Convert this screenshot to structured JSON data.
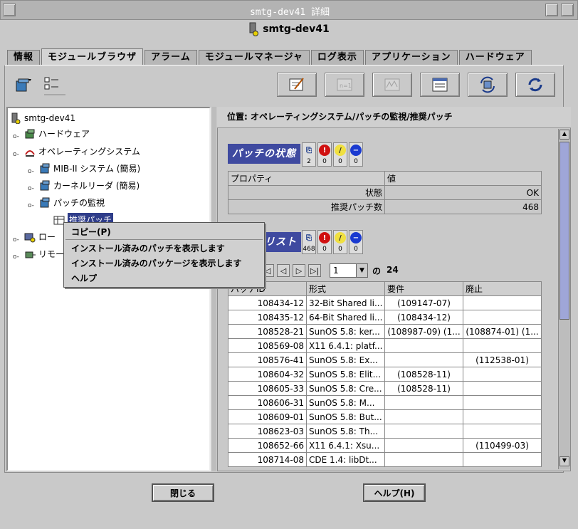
{
  "window": {
    "title": "smtg-dev41 詳細",
    "header": "smtg-dev41"
  },
  "tabs": [
    {
      "label": "情報"
    },
    {
      "label": "モジュールブラウザ",
      "active": true
    },
    {
      "label": "アラーム"
    },
    {
      "label": "モジュールマネージャ"
    },
    {
      "label": "ログ表示"
    },
    {
      "label": "アプリケーション"
    },
    {
      "label": "ハードウェア"
    }
  ],
  "tree": {
    "root": "smtg-dev41",
    "items": {
      "hardware": "ハードウェア",
      "os": "オペレーティングシステム",
      "mib2": "MIB-II システム (簡易)",
      "kernel": "カーネルリーダ (簡易)",
      "patch_monitor": "パッチの監視",
      "recommended": "推奨パッチ",
      "local": "ロー",
      "remote": "リモー"
    }
  },
  "context_menu": {
    "copy": "コピー(P)",
    "show_installed_patches": "インストール済みのパッチを表示します",
    "show_installed_packages": "インストール済みのパッケージを表示します",
    "help": "ヘルプ"
  },
  "location": "位置:  オペレーティングシステム/パッチの監視/推奨パッチ",
  "status_section": {
    "title": "パッチの状態",
    "counts": [
      "2",
      "0",
      "0",
      "0"
    ],
    "headers": [
      "プロパティ",
      "値"
    ],
    "rows": [
      [
        "状態",
        "OK"
      ],
      [
        "推奨パッチ数",
        "468"
      ]
    ]
  },
  "list_section": {
    "title": "リスト",
    "counts": [
      "468",
      "0",
      "0",
      "0"
    ],
    "page": "1",
    "of_label": "の",
    "total_pages": "24",
    "headers": [
      "パッチID",
      "形式",
      "要件",
      "廃止"
    ],
    "rows": [
      [
        "108434-12",
        "32-Bit Shared li...",
        "(109147-07)",
        ""
      ],
      [
        "108435-12",
        "64-Bit Shared li...",
        "(108434-12)",
        ""
      ],
      [
        "108528-21",
        "SunOS 5.8: ker...",
        "(108987-09) (1...",
        "(108874-01) (1..."
      ],
      [
        "108569-08",
        "X11 6.4.1: platf...",
        "",
        ""
      ],
      [
        "108576-41",
        "SunOS 5.8: Ex...",
        "",
        "(112538-01)"
      ],
      [
        "108604-32",
        "SunOS 5.8: Elit...",
        "(108528-11)",
        ""
      ],
      [
        "108605-33",
        "SunOS 5.8: Cre...",
        "(108528-11)",
        ""
      ],
      [
        "108606-31",
        "SunOS 5.8:   M...",
        "",
        ""
      ],
      [
        "108609-01",
        "SunOS 5.8: But...",
        "",
        ""
      ],
      [
        "108623-03",
        "SunOS 5.8: Th...",
        "",
        ""
      ],
      [
        "108652-66",
        "X11 6.4.1: Xsu...",
        "",
        "(110499-03)"
      ],
      [
        "108714-08",
        "CDE 1.4: libDt...",
        "",
        ""
      ]
    ]
  },
  "buttons": {
    "close": "閉じる",
    "help": "ヘルプ(H)"
  },
  "colors": {
    "section_title_bg": "#3f4aa0",
    "selection": "#2f3d8a"
  }
}
